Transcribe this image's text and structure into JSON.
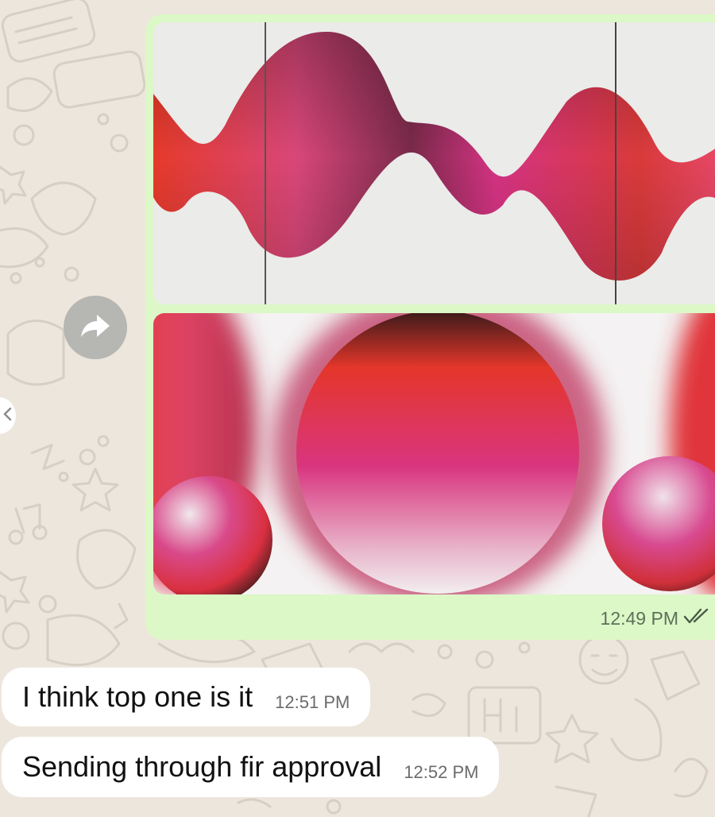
{
  "outgoing": {
    "time": "12:49 PM",
    "status_icon": "double-check-icon",
    "images": [
      {
        "name": "wave-artwork",
        "palette": [
          "#e83a2c",
          "#d63384",
          "#5a1a2a"
        ]
      },
      {
        "name": "spheres-artwork",
        "palette": [
          "#e4362a",
          "#d9357f",
          "#eee6ea"
        ]
      }
    ]
  },
  "incoming": [
    {
      "text": "I think top one is it",
      "time": "12:51 PM"
    },
    {
      "text": "Sending through fir approval",
      "time": "12:52 PM"
    }
  ],
  "forward_button": {
    "icon": "forward-arrow-icon"
  },
  "colors": {
    "wallpaper": "#ede6dd",
    "outgoing_bubble": "#dcf8c6",
    "incoming_bubble": "#ffffff"
  }
}
